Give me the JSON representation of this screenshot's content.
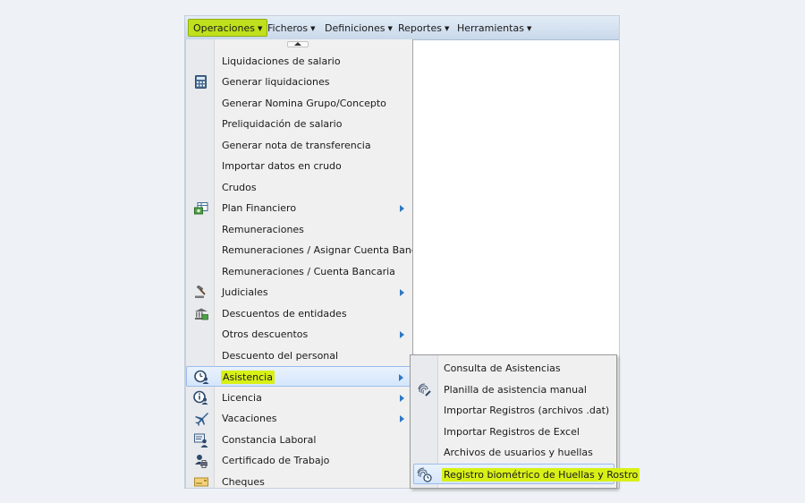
{
  "menubar": {
    "items": [
      {
        "label": "Operaciones",
        "active": true
      },
      {
        "label": "Ficheros"
      },
      {
        "label": "Definiciones"
      },
      {
        "label": "Reportes"
      },
      {
        "label": "Herramientas"
      }
    ]
  },
  "operaciones_menu": {
    "items": [
      {
        "label": "Liquidaciones de salario"
      },
      {
        "label": "Generar liquidaciones",
        "icon": "calculator-icon"
      },
      {
        "label": "Generar Nomina Grupo/Concepto"
      },
      {
        "label": "Preliquidación de salario"
      },
      {
        "label": "Generar nota de transferencia"
      },
      {
        "label": "Importar datos en crudo"
      },
      {
        "label": "Crudos"
      },
      {
        "label": "Plan Financiero",
        "icon": "money-table-icon",
        "submenu": true
      },
      {
        "label": "Remuneraciones"
      },
      {
        "label": "Remuneraciones / Asignar Cuenta Bancaria"
      },
      {
        "label": "Remuneraciones / Cuenta Bancaria"
      },
      {
        "label": "Judiciales",
        "icon": "gavel-icon",
        "submenu": true
      },
      {
        "label": "Descuentos de entidades",
        "icon": "bank-icon"
      },
      {
        "label": "Otros descuentos",
        "submenu": true
      },
      {
        "label": "Descuento del personal"
      },
      {
        "label": "Asistencia",
        "icon": "user-clock-icon",
        "submenu": true,
        "highlighted": true
      },
      {
        "label": "Licencia",
        "icon": "user-info-icon",
        "submenu": true
      },
      {
        "label": "Vacaciones",
        "icon": "airplane-icon",
        "submenu": true
      },
      {
        "label": "Constancia Laboral",
        "icon": "id-card-icon"
      },
      {
        "label": "Certificado de Trabajo",
        "icon": "user-printer-icon"
      },
      {
        "label": "Cheques",
        "icon": "cheque-icon"
      }
    ]
  },
  "asistencia_submenu": {
    "items": [
      {
        "label": "Consulta de Asistencias"
      },
      {
        "label": "Planilla de asistencia manual",
        "icon": "fingerprint-pen-icon"
      },
      {
        "label": "Importar Registros (archivos .dat)"
      },
      {
        "label": "Importar Registros de Excel"
      },
      {
        "label": "Archivos de usuarios y huellas"
      },
      {
        "label": "Registro biométrico de Huellas y Rostro",
        "icon": "fingerprint-clock-icon",
        "highlighted": true
      }
    ]
  },
  "colors": {
    "highlight": "#d8f016",
    "menubar": "#c9d8ea",
    "submenu_arrow": "#2f78c4"
  }
}
